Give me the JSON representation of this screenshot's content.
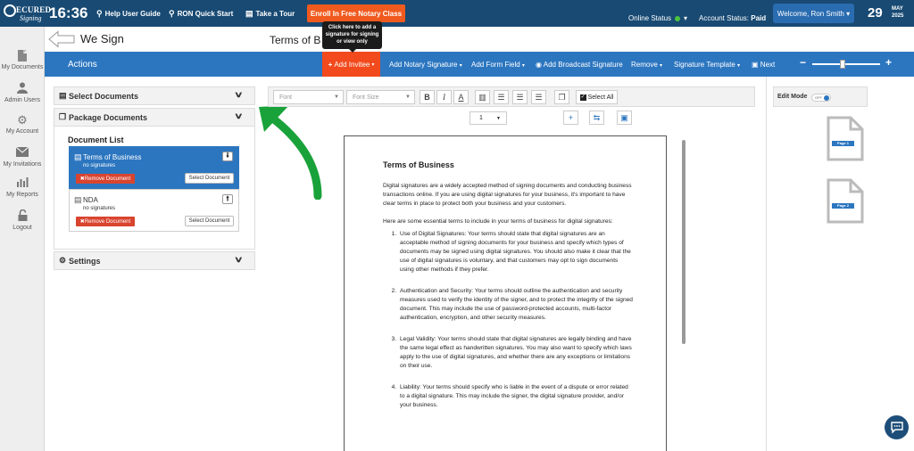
{
  "header": {
    "logo_line1": "ECURED",
    "logo_line2": "Signing",
    "time": "16:36",
    "help_guide": "Help User Guide",
    "ron_quick_start": "RON Quick Start",
    "take_tour": "Take a Tour",
    "enroll_button": "Enroll In Free Notary Class",
    "online_status_label": "Online Status",
    "account_status_label": "Account Status:",
    "account_status_value": "Paid",
    "welcome": "Welcome,  Ron Smith ▾",
    "day": "29",
    "month": "MAY",
    "year": "2025"
  },
  "sidebar": {
    "items": [
      {
        "label": "My Documents",
        "icon": "document-icon"
      },
      {
        "label": "Admin Users",
        "icon": "user-icon"
      },
      {
        "label": "My Account",
        "icon": "gear-icon"
      },
      {
        "label": "My Invitations",
        "icon": "envelope-icon"
      },
      {
        "label": "My Reports",
        "icon": "bar-chart-icon"
      },
      {
        "label": "Logout",
        "icon": "lock-icon"
      }
    ]
  },
  "titlebar": {
    "page_title": "We Sign",
    "document_title": "Terms of B",
    "tooltip": "Click here to add a signature for signing or view only"
  },
  "actions": {
    "label": "Actions",
    "add_invitee": "Add Invitee",
    "add_notary_signature": "Add Notary Signature",
    "add_form_field": "Add Form Field",
    "add_broadcast_signature": "Add Broadcast Signature",
    "remove": "Remove",
    "signature_template": "Signature Template",
    "next": "Next",
    "zoom_level": 0.45
  },
  "left_panel": {
    "select_documents": "Select Documents",
    "package_documents": "Package Documents",
    "settings": "Settings",
    "document_list_heading": "Document List",
    "documents": [
      {
        "name": "Terms of Business",
        "status": "no signatures",
        "remove_label": "Remove Document",
        "select_label": "Select Document",
        "selected": true
      },
      {
        "name": "NDA",
        "status": "no signatures",
        "remove_label": "Remove Document",
        "select_label": "Select Document",
        "selected": false
      }
    ]
  },
  "toolbar": {
    "font_placeholder": "Font",
    "font_size_placeholder": "Font Size",
    "select_all": "Select All"
  },
  "page_controls": {
    "current_page": "1"
  },
  "document": {
    "heading": "Terms of Business",
    "intro": "Digital signatures are a widely accepted method of signing documents and conducting business transactions online. If you are using digital signatures for your business, it's important to have clear terms in place to protect both your business and your customers.",
    "list_intro": "Here are some essential terms to include in your terms of business for digital signatures:",
    "items": [
      "Use of Digital Signatures: Your terms should state that digital signatures are an acceptable method of signing documents for your business and specify which types of documents may be signed using digital signatures. You should also make it clear that the use of digital signatures is voluntary, and that customers may opt to sign documents using other methods if they prefer.",
      "Authentication and Security: Your terms should outline the authentication and security measures used to verify the identity of the signer, and to protect the integrity of the signed document. This may include the use of password-protected accounts, multi-factor authentication, encryption, and other security measures.",
      "Legal Validity: Your terms should state that digital signatures are legally binding and have the same legal effect as handwritten signatures. You may also want to specify which laws apply to the use of digital signatures, and whether there are any exceptions or limitations on their use.",
      "Liability: Your terms should specify who is liable in the event of a dispute or error related to a digital signature. This may include the signer, the digital signature provider, and/or your business."
    ]
  },
  "right_panel": {
    "edit_mode_label": "Edit Mode",
    "toggle_state": "OFF",
    "thumbnails": [
      "Page 1",
      "Page 2"
    ]
  },
  "colors": {
    "header_bg": "#184a73",
    "actions_bg": "#2c76c0",
    "accent_orange": "#f05a1e",
    "add_invitee_bg": "#f24a1c",
    "remove_red": "#d9442f",
    "arrow_green": "#1aa23a"
  }
}
